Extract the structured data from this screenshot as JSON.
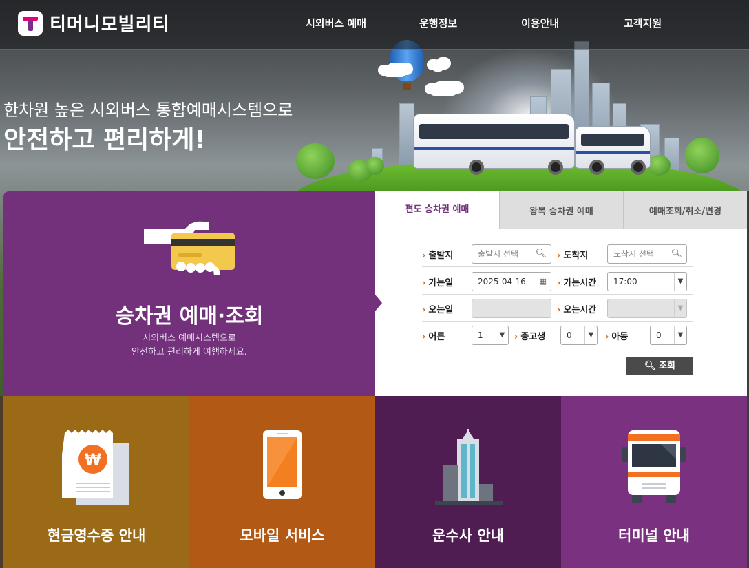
{
  "header": {
    "logo_text": "티머니모빌리티",
    "nav": [
      "시외버스 예매",
      "운행정보",
      "이용안내",
      "고객지원"
    ]
  },
  "hero": {
    "subtitle": "한차원 높은 시외버스 통합예매시스템으로",
    "title": "안전하고 편리하게!"
  },
  "booking_panel": {
    "title": "승차권 예매·조회",
    "desc_line1": "시외버스 예매시스템으로",
    "desc_line2": "안전하고 편리하게 여행하세요."
  },
  "tabs": [
    {
      "label": "편도 승차권 예매",
      "active": true
    },
    {
      "label": "왕복 승차권 예매",
      "active": false
    },
    {
      "label": "예매조회/취소/변경",
      "active": false
    }
  ],
  "form": {
    "departure_label": "출발지",
    "departure_placeholder": "출발지 선택",
    "arrival_label": "도착지",
    "arrival_placeholder": "도착지 선택",
    "go_date_label": "가는일",
    "go_date_value": "2025-04-16",
    "go_time_label": "가는시간",
    "go_time_value": "17:00",
    "return_date_label": "오는일",
    "return_date_value": "",
    "return_time_label": "오는시간",
    "return_time_value": "",
    "adult_label": "어른",
    "adult_value": "1",
    "youth_label": "중고생",
    "youth_value": "0",
    "child_label": "아동",
    "child_value": "0",
    "search_label": "조회"
  },
  "tiles": [
    {
      "label": "현금영수증 안내",
      "color": "#9b6a16",
      "icon": "receipt-won-icon"
    },
    {
      "label": "모바일 서비스",
      "color": "#b25a15",
      "icon": "mobile-phone-icon"
    },
    {
      "label": "운수사 안내",
      "color": "#4f1d52",
      "icon": "office-building-icon"
    },
    {
      "label": "터미널 안내",
      "color": "#7a3280",
      "icon": "bus-front-icon"
    }
  ],
  "colors": {
    "brand_purple": "#72317a",
    "accent_orange": "#d2691e",
    "search_button": "#4a4a4a"
  }
}
